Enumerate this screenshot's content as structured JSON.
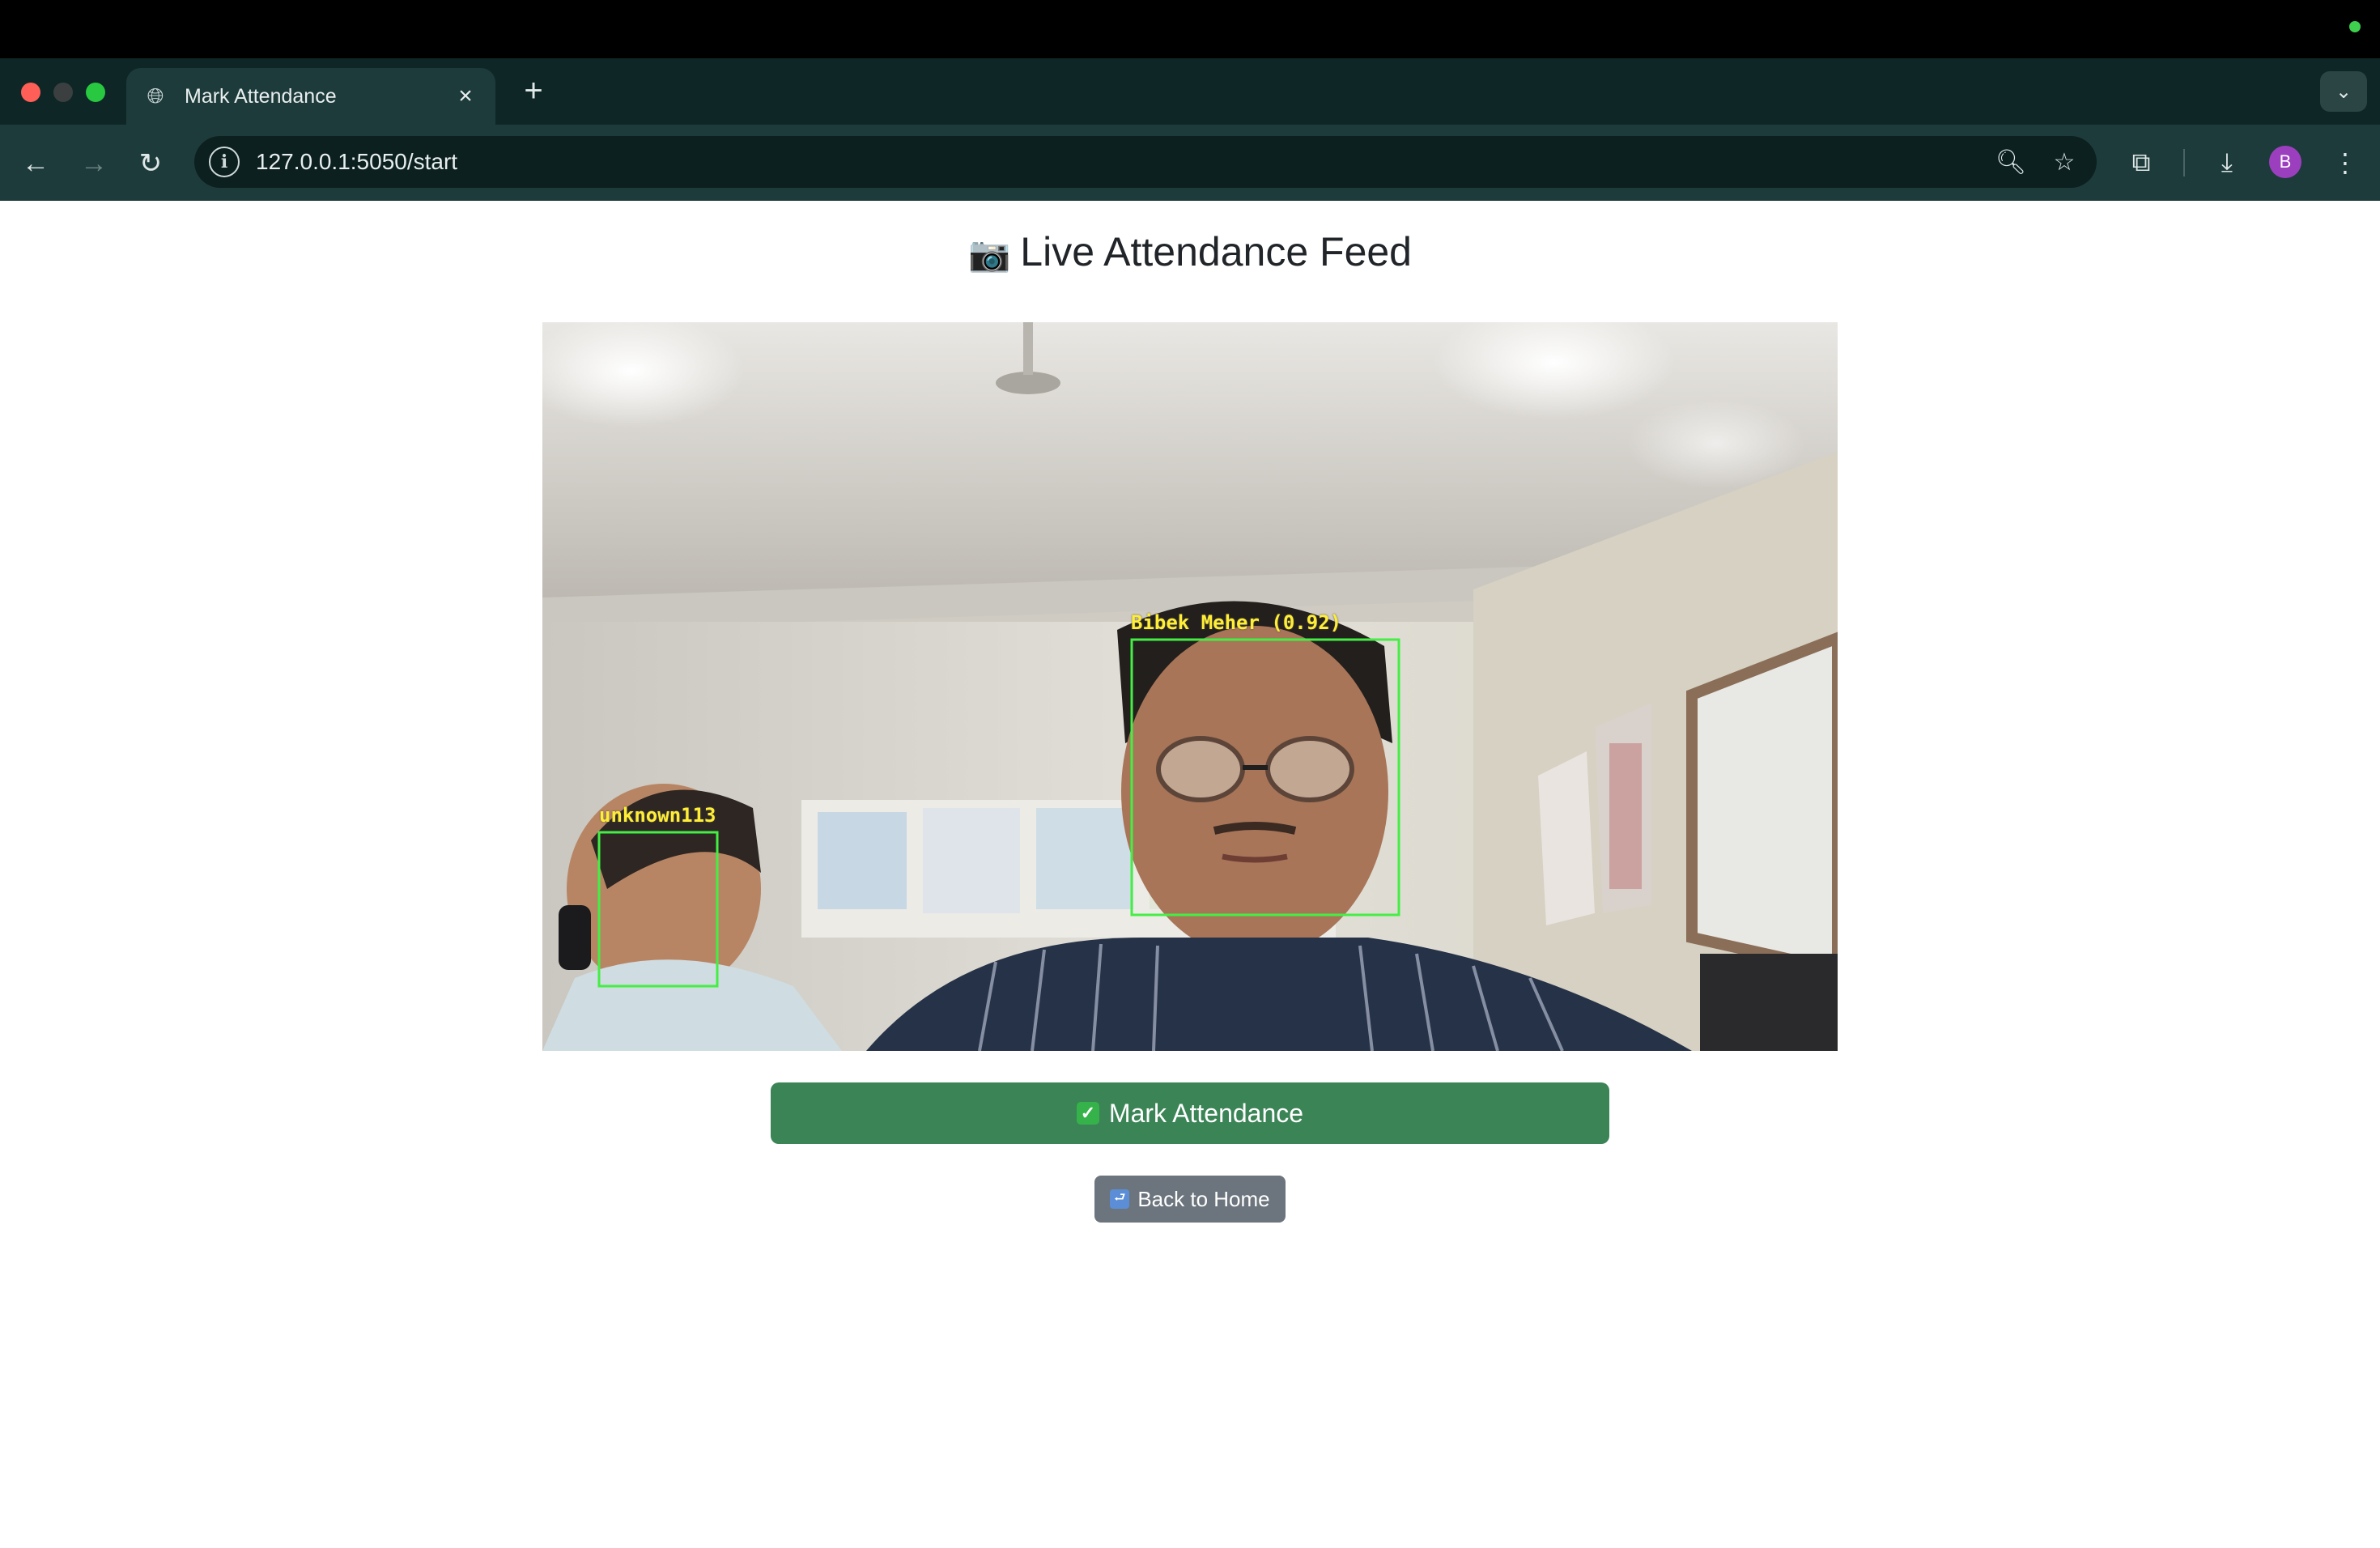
{
  "browser": {
    "tab": {
      "title": "Mark Attendance",
      "close_glyph": "×"
    },
    "new_tab_glyph": "+",
    "tab_search_glyph": "⌄",
    "nav": {
      "back_glyph": "←",
      "forward_glyph": "→",
      "reload_glyph": "↻"
    },
    "omnibox": {
      "info_glyph": "i",
      "url": "127.0.0.1:5050/start"
    },
    "icons": {
      "zoom": "🔍︎",
      "bookmark": "☆",
      "extensions": "⧉",
      "download": "⤓",
      "menu": "⋮"
    },
    "profile_initial": "B",
    "accent_colors": {
      "tabstrip": "#0f2626",
      "toolbar": "#1e3b3b",
      "profile": "#9c3fbf"
    }
  },
  "page": {
    "title_icon": "📷",
    "title": "Live Attendance Feed",
    "video_feed": {
      "detections": [
        {
          "label": "Bibek Meher (0.92)",
          "color": "#44ee44"
        },
        {
          "label": "unknown113",
          "color": "#44ee44"
        }
      ]
    },
    "mark_button": {
      "icon": "✓",
      "label": "Mark Attendance",
      "color": "#3a8456"
    },
    "back_button": {
      "icon": "⮐",
      "label": "Back to Home",
      "color": "#6c757d"
    }
  }
}
